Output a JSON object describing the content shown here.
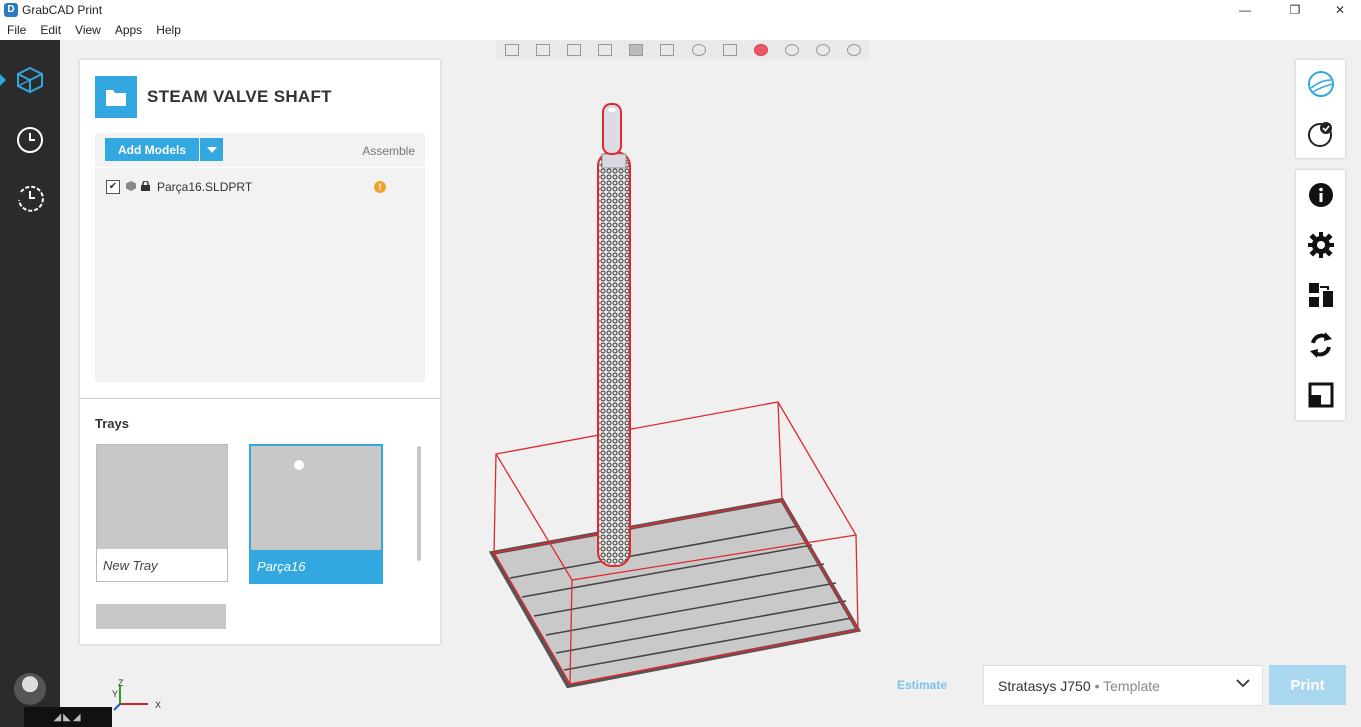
{
  "window": {
    "title": "GrabCAD Print",
    "logo_glyph": "D",
    "min_glyph": "—",
    "max_glyph": "❐",
    "close_glyph": "✕"
  },
  "menu": [
    "File",
    "Edit",
    "View",
    "Apps",
    "Help"
  ],
  "sidebar_icons": [
    "cube-icon",
    "clock-icon",
    "history-icon"
  ],
  "project": {
    "title": "STEAM VALVE SHAFT"
  },
  "models": {
    "add_label": "Add Models",
    "assemble_label": "Assemble",
    "items": [
      {
        "name": "Parça16.SLDPRT",
        "checked": true,
        "warning": "!"
      }
    ]
  },
  "trays": {
    "title": "Trays",
    "items": [
      {
        "label": "New Tray",
        "selected": false
      },
      {
        "label": "Parça16",
        "selected": true
      }
    ]
  },
  "footer": {
    "estimate_label": "Estimate",
    "printer_name": "Stratasys J750",
    "printer_template": "• Template",
    "print_label": "Print",
    "taskbar_glyphs": "◢◣◢"
  },
  "axes": {
    "x": "X",
    "y": "Y",
    "z": "Z"
  },
  "colors": {
    "accent": "#33a7e0",
    "bounds": "#e0282e",
    "sidebar": "#2b2b2b",
    "warning": "#f0a030"
  }
}
